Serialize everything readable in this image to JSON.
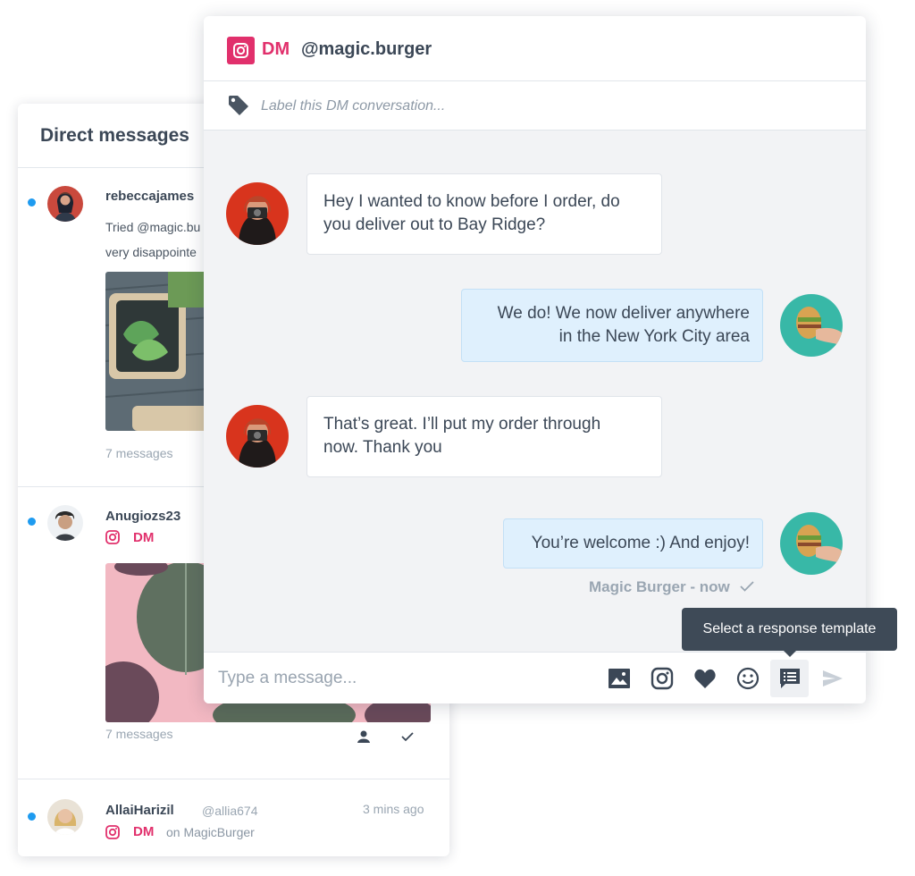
{
  "inbox": {
    "title": "Direct messages",
    "items": [
      {
        "name": "rebeccajames",
        "text": "Tried @magic.burger last night and was very disappointed with the service",
        "line1": "Tried @magic.bu",
        "line2": "very disappointe",
        "count": "7 messages"
      },
      {
        "name": "Anugiozs23",
        "channel": "DM",
        "count": "7 messages"
      },
      {
        "name": "AllaiHarizil",
        "handle": "@allia674",
        "time": "3 mins ago",
        "channel": "DM",
        "on": "on MagicBurger"
      }
    ]
  },
  "conversation": {
    "channel": "DM",
    "handle": "@magic.burger",
    "label_placeholder": "Label this DM conversation...",
    "messages": [
      {
        "direction": "in",
        "lines": [
          "Hey I wanted to know before I order, do",
          "you deliver out to Bay Ridge?"
        ]
      },
      {
        "direction": "out",
        "lines": [
          "We do! We now deliver anywhere",
          "in the New York City area"
        ]
      },
      {
        "direction": "in",
        "lines": [
          "That’s great. I’ll put my order through",
          "now. Thank you"
        ]
      },
      {
        "direction": "out",
        "lines": [
          "You’re welcome :) And enjoy!"
        ]
      }
    ],
    "status": "Magic Burger - now",
    "tooltip": "Select a response template",
    "composer_placeholder": "Type a message..."
  },
  "icons": [
    "instagram-icon",
    "tag-icon",
    "image-icon",
    "heart-icon",
    "smile-icon",
    "template-icon",
    "send-icon",
    "person-icon",
    "check-icon"
  ],
  "colors": {
    "instagram": "#e1306c",
    "unread": "#1e9bf0",
    "outgoing_bubble": "#dff0fd",
    "tooltip": "#3e4a57"
  }
}
